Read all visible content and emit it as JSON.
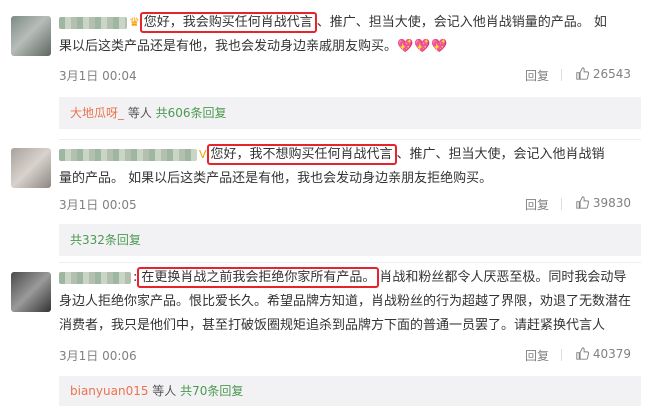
{
  "comments": [
    {
      "prefix_symbol": "👑",
      "highlight": "您好，我会购买任何肖战代言",
      "rest_line1": "、推广、担当大使，会记入他肖战销量的产品。 如",
      "line2": "果以后这类产品还是有他，我也会发动身边亲戚朋友购买。",
      "emoji": "💖💖💖",
      "date": "3月1日 00:04",
      "reply_label": "回复",
      "like_count": "26543",
      "reply_summary": {
        "user": "大地瓜呀_",
        "mid": " 等人 ",
        "count": "共606条回复"
      }
    },
    {
      "badge": "V",
      "highlight": "您好，我不想购买任何肖战代言",
      "rest_line1": "、推广、担当大使，会记入他肖战销",
      "line2": "量的产品。 如果以后这类产品还是有他，我也会发动身边亲朋友拒绝购买。",
      "date": "3月1日 00:05",
      "reply_label": "回复",
      "like_count": "39830",
      "reply_summary": {
        "count": "共332条回复"
      }
    },
    {
      "colon": ":",
      "highlight": "在更换肖战之前我会拒绝你家所有产品。",
      "rest_line1": "肖战和粉丝都令人厌恶至极。同时我会动导",
      "line2": "身边人拒绝你家产品。恨比爱长久。希望品牌方知道，肖战粉丝的行为超越了界限，劝退了无数潜在",
      "line3": "消费者，我只是他们中，甚至打破饭圈规矩追杀到品牌方下面的普通一员罢了。请赶紧换代言人",
      "date": "3月1日 00:06",
      "reply_label": "回复",
      "like_count": "40379",
      "reply_summary": {
        "user": "bianyuan015",
        "mid": " 等人 ",
        "count": "共70条回复"
      }
    }
  ],
  "icons": {
    "like": "thumbs-up-icon",
    "crown": "crown-icon",
    "verified": "verified-badge-icon"
  },
  "colors": {
    "highlight_border": "#e8232c",
    "link": "#eb7350",
    "reply_count": "#4c9a50"
  }
}
